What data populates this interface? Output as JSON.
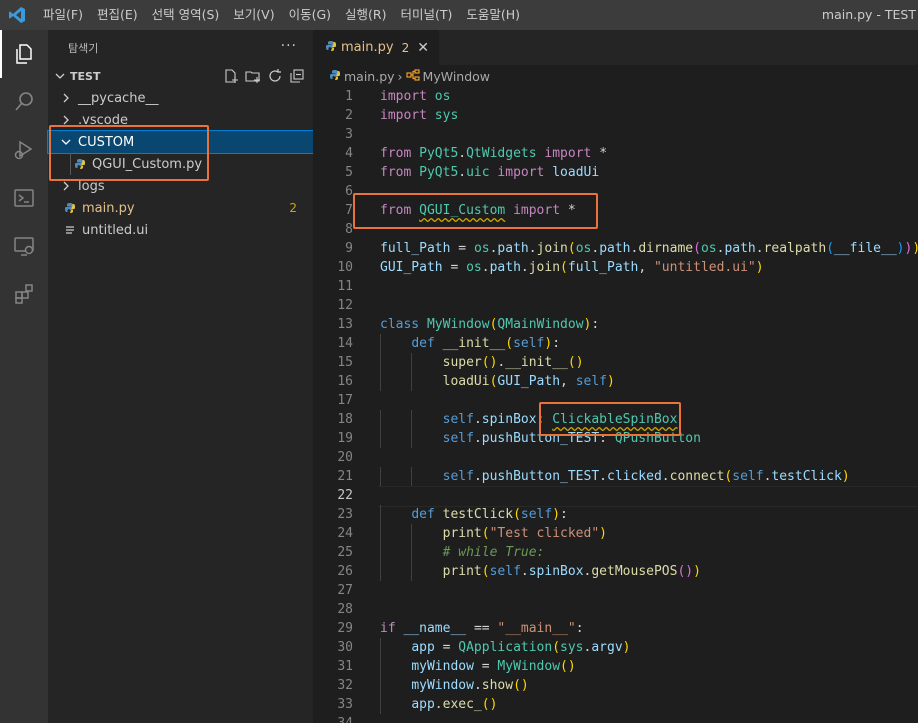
{
  "menu": [
    "파일(F)",
    "편집(E)",
    "선택 영역(S)",
    "보기(V)",
    "이동(G)",
    "실행(R)",
    "터미널(T)",
    "도움말(H)"
  ],
  "window_title": "main.py - TEST",
  "activity_icons": [
    "explorer-icon",
    "search-icon",
    "run-debug-icon",
    "terminal-icon",
    "remote-explorer-icon",
    "extensions-icon"
  ],
  "explorer": {
    "title": "탐색기",
    "more": "···",
    "workspace": "TEST",
    "items": [
      {
        "label": "__pycache__",
        "kind": "folder",
        "expanded": false
      },
      {
        "label": ".vscode",
        "kind": "folder",
        "expanded": false
      },
      {
        "label": "CUSTOM",
        "kind": "folder",
        "expanded": true,
        "selected": true
      },
      {
        "label": "QGUI_Custom.py",
        "kind": "python-file",
        "indent": 1
      },
      {
        "label": "logs",
        "kind": "folder",
        "expanded": false
      },
      {
        "label": "main.py",
        "kind": "python-file",
        "modified": true,
        "badge": "2"
      },
      {
        "label": "untitled.ui",
        "kind": "file"
      }
    ]
  },
  "tab": {
    "name": "main.py",
    "problems": "2",
    "close": "✕"
  },
  "breadcrumb": {
    "file": "main.py",
    "separator": "›",
    "symbol": "MyWindow"
  },
  "code": {
    "current_line": 22,
    "lines": [
      {
        "n": "1",
        "text": "import os"
      },
      {
        "n": "2",
        "text": "import sys"
      },
      {
        "n": "3",
        "text": ""
      },
      {
        "n": "4",
        "text": "from PyQt5.QtWidgets import *"
      },
      {
        "n": "5",
        "text": "from PyQt5.uic import loadUi"
      },
      {
        "n": "6",
        "text": ""
      },
      {
        "n": "7",
        "text": "from QGUI_Custom import *"
      },
      {
        "n": "8",
        "text": ""
      },
      {
        "n": "9",
        "text": "full_Path = os.path.join(os.path.dirname(os.path.realpath(__file__)))"
      },
      {
        "n": "10",
        "text": "GUI_Path = os.path.join(full_Path, \"untitled.ui\")"
      },
      {
        "n": "11",
        "text": ""
      },
      {
        "n": "12",
        "text": ""
      },
      {
        "n": "13",
        "text": "class MyWindow(QMainWindow):"
      },
      {
        "n": "14",
        "text": "    def __init__(self):"
      },
      {
        "n": "15",
        "text": "        super().__init__()"
      },
      {
        "n": "16",
        "text": "        loadUi(GUI_Path, self)"
      },
      {
        "n": "17",
        "text": ""
      },
      {
        "n": "18",
        "text": "        self.spinBox: ClickableSpinBox"
      },
      {
        "n": "19",
        "text": "        self.pushButton_TEST: QPushButton"
      },
      {
        "n": "20",
        "text": ""
      },
      {
        "n": "21",
        "text": "        self.pushButton_TEST.clicked.connect(self.testClick)"
      },
      {
        "n": "22",
        "text": ""
      },
      {
        "n": "23",
        "text": "    def testClick(self):"
      },
      {
        "n": "24",
        "text": "        print(\"Test clicked\")"
      },
      {
        "n": "25",
        "text": "        # while True:"
      },
      {
        "n": "26",
        "text": "        print(self.spinBox.getMousePOS())"
      },
      {
        "n": "27",
        "text": ""
      },
      {
        "n": "28",
        "text": ""
      },
      {
        "n": "29",
        "text": "if __name__ == \"__main__\":"
      },
      {
        "n": "30",
        "text": "    app = QApplication(sys.argv)"
      },
      {
        "n": "31",
        "text": "    myWindow = MyWindow()"
      },
      {
        "n": "32",
        "text": "    myWindow.show()"
      },
      {
        "n": "33",
        "text": "    app.exec_()"
      },
      {
        "n": "34",
        "text": ""
      }
    ]
  },
  "colors": {
    "highlight_box": "#e8743b",
    "selection": "#094771",
    "warning": "#cca700"
  }
}
